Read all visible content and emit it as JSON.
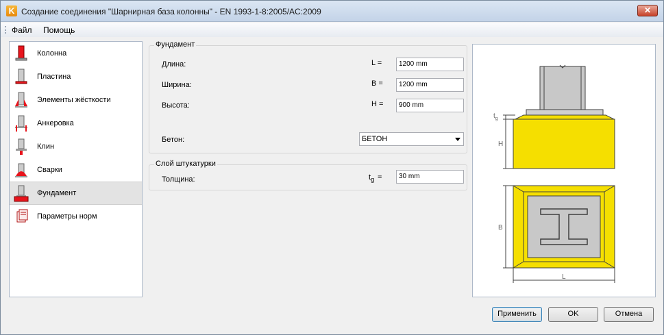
{
  "window": {
    "title": "Создание соединения \"Шарнирная база колонны\" - EN 1993-1-8:2005/AC:2009",
    "app_icon_letter": "K",
    "close_symbol": "✕"
  },
  "menu": {
    "file": "Файл",
    "help": "Помощь"
  },
  "nav": {
    "items": [
      {
        "label": "Колонна",
        "icon": "column-icon"
      },
      {
        "label": "Пластина",
        "icon": "plate-icon"
      },
      {
        "label": "Элементы жёсткости",
        "icon": "stiffeners-icon"
      },
      {
        "label": "Анкеровка",
        "icon": "anchorage-icon"
      },
      {
        "label": "Клин",
        "icon": "shear-key-icon"
      },
      {
        "label": "Сварки",
        "icon": "welds-icon"
      },
      {
        "label": "Фундамент",
        "icon": "foundation-icon",
        "selected": true
      },
      {
        "label": "Параметры норм",
        "icon": "code-params-icon"
      }
    ]
  },
  "foundation": {
    "title": "Фундамент",
    "length_label": "Длина:",
    "length_sym": "L =",
    "length_value": "1200 mm",
    "width_label": "Ширина:",
    "width_sym": "B =",
    "width_value": "1200 mm",
    "height_label": "Высота:",
    "height_sym": "H =",
    "height_value": "900 mm",
    "concrete_label": "Бетон:",
    "concrete_value": "БЕТОН"
  },
  "grout": {
    "title": "Слой штукатурки",
    "thickness_label": "Толщина:",
    "thickness_sym": "t",
    "thickness_sub": "g",
    "thickness_eq": "=",
    "thickness_value": "30 mm"
  },
  "preview": {
    "tg_label": "t",
    "tg_sub": "g",
    "h_label": "H",
    "b_label": "B",
    "l_label": "L",
    "colors": {
      "concrete": "#f5df00",
      "steel": "#c8c8c8",
      "outline": "#404040"
    }
  },
  "buttons": {
    "apply": "Применить",
    "ok": "OK",
    "cancel": "Отмена"
  }
}
